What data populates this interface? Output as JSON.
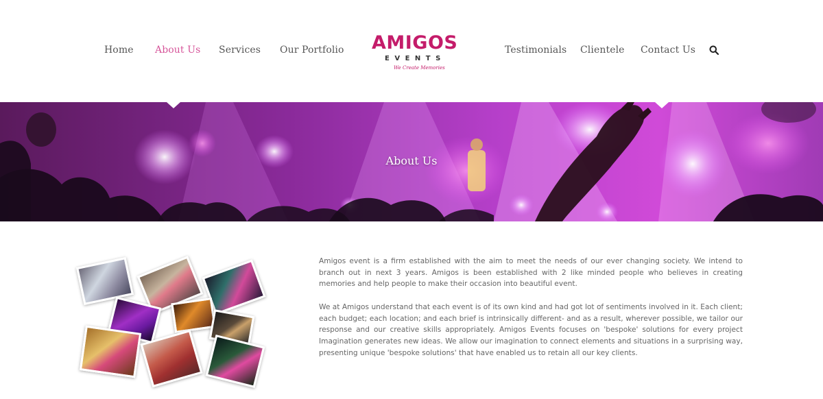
{
  "nav": {
    "left": [
      {
        "label": "Home",
        "active": false
      },
      {
        "label": "About Us",
        "active": true
      },
      {
        "label": "Services",
        "active": false
      },
      {
        "label": "Our Portfolio",
        "active": false
      }
    ],
    "right": [
      {
        "label": "Testimonials",
        "active": false
      },
      {
        "label": "Clientele",
        "active": false
      },
      {
        "label": "Contact Us",
        "active": false
      }
    ],
    "search_icon": "search-icon"
  },
  "logo": {
    "word": "AMIGOS",
    "sub": "EVENTS",
    "tagline": "We Create Memories"
  },
  "banner": {
    "title": "About Us"
  },
  "content": {
    "paragraphs": [
      "Amigos event is a firm established with the aim to meet the needs of our ever changing society. We intend to branch out in next 3 years. Amigos is been established with 2 like minded people who believes in creating memories and help people to make their occasion into beautiful event.",
      "We at Amigos understand that each event is of its own kind and had got lot of sentiments involved in it. Each client; each budget; each location; and each brief is intrinsically different- and as a result, wherever possible, we tailor our response and our creative skills appropriately. Amigos Events focuses on 'bespoke' solutions for every project Imagination generates new ideas. We allow our imagination to connect elements and situations in a surprising way, presenting unique 'bespoke solutions' that have enabled us to retain all our key clients."
    ]
  },
  "colors": {
    "accent": "#d6559a",
    "brand": "#c41c6a",
    "nav_text": "#555555",
    "body_text": "#666666"
  }
}
